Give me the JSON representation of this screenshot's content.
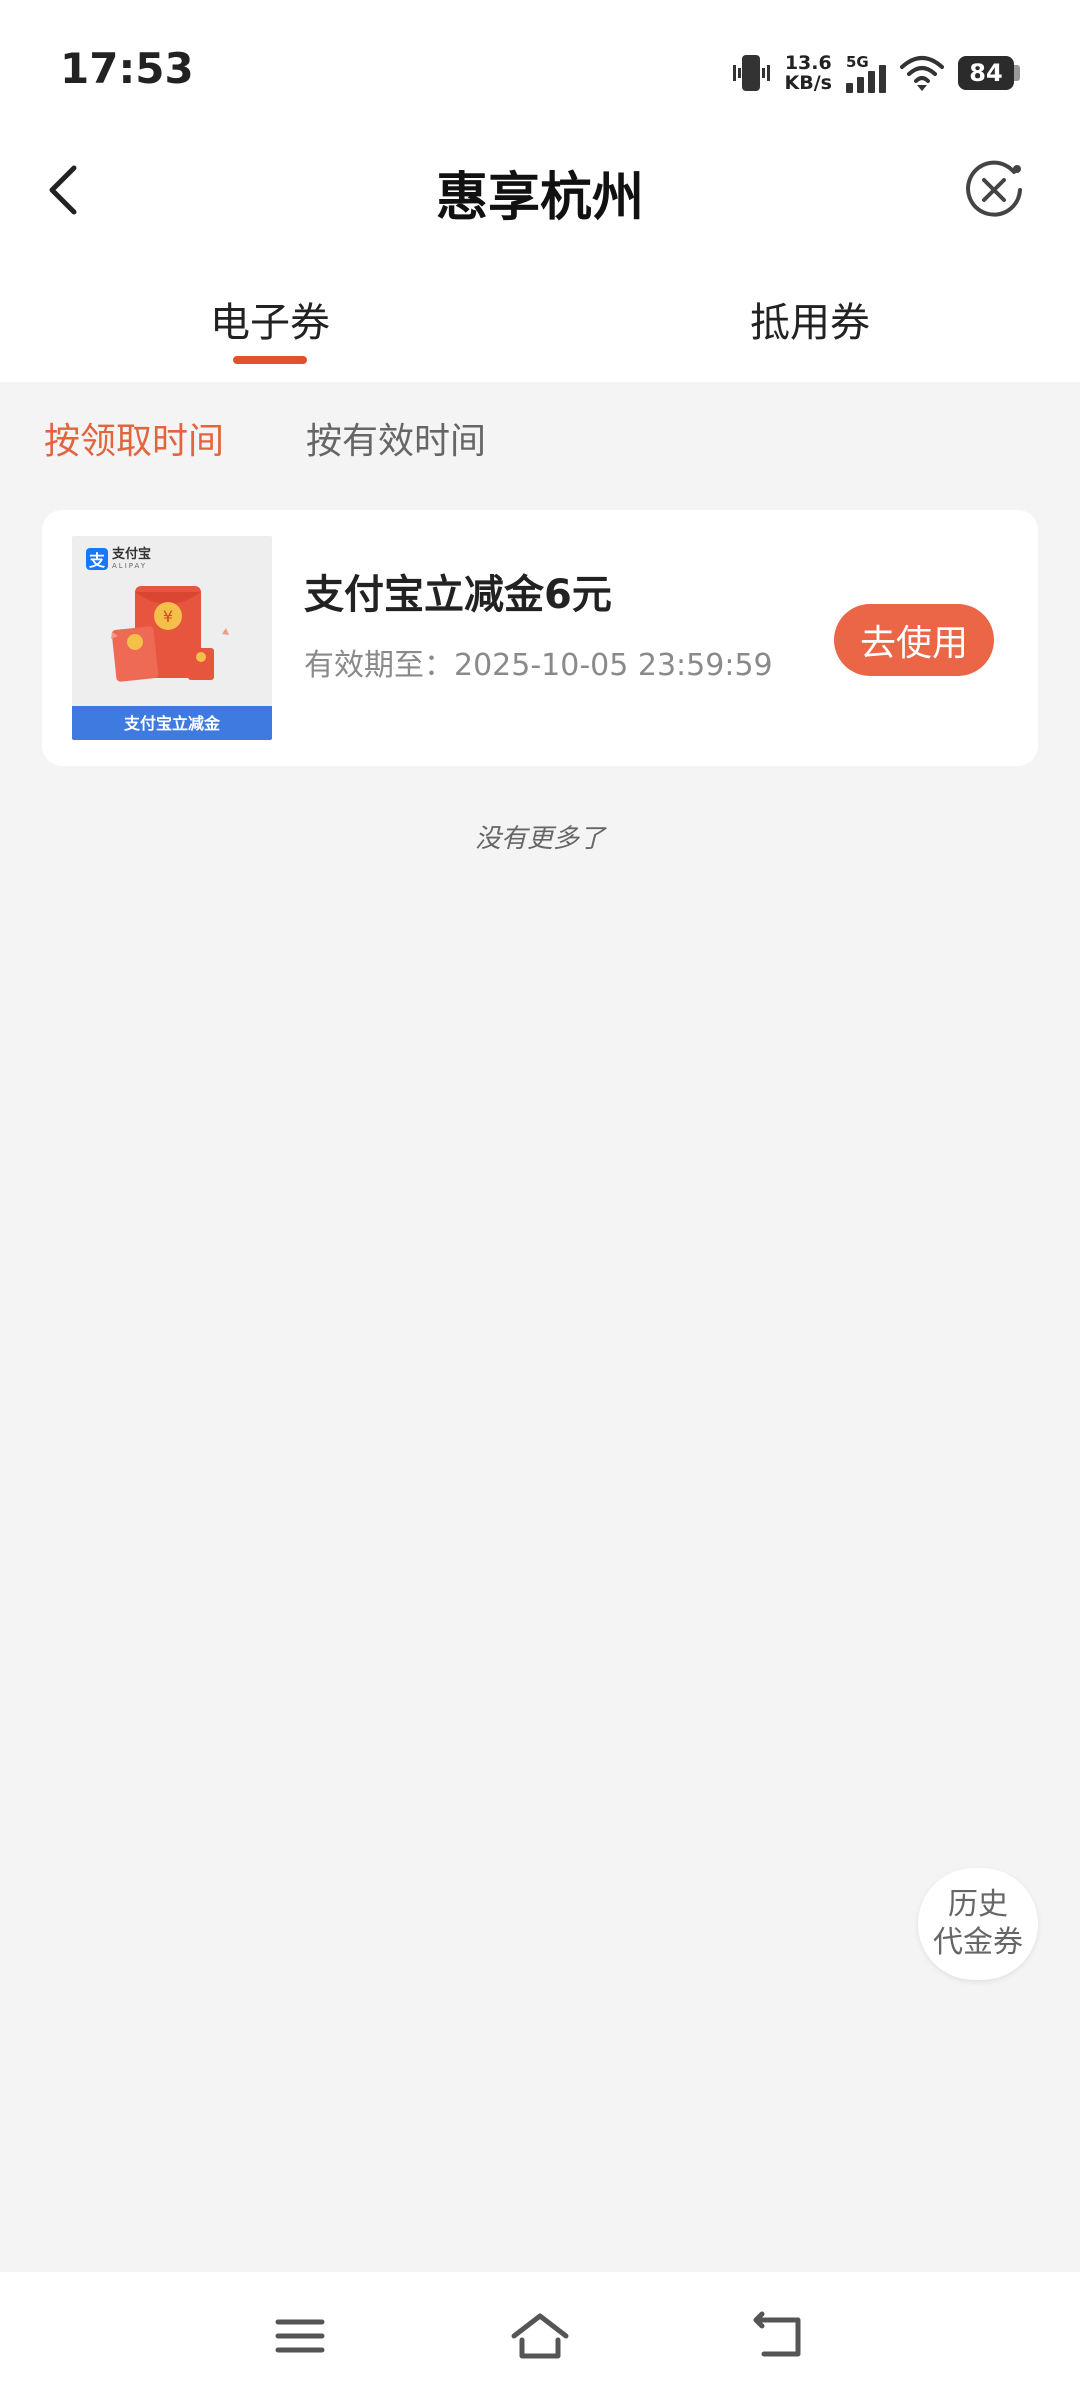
{
  "status_bar": {
    "time": "17:53",
    "net_speed_value": "13.6",
    "net_speed_unit": "KB/s",
    "network_type": "5G",
    "battery": "84"
  },
  "nav": {
    "title": "惠享杭州",
    "back_icon": "back-arrow-icon",
    "close_icon": "close-circle-icon"
  },
  "tabs": [
    {
      "label": "电子券",
      "active": true
    },
    {
      "label": "抵用券",
      "active": false
    }
  ],
  "sort_options": [
    {
      "label": "按领取时间",
      "active": true
    },
    {
      "label": "按有效时间",
      "active": false
    }
  ],
  "coupon": {
    "thumb_logo_text": "支付宝",
    "thumb_logo_sub": "ALIPAY",
    "thumb_banner": "支付宝立减金",
    "name": "支付宝立减金6元",
    "validity": "有效期至：2025-10-05 23:59:59",
    "action_label": "去使用"
  },
  "list_end_text": "没有更多了",
  "history_button": {
    "line1": "历史",
    "line2": "代金券"
  },
  "colors": {
    "accent": "#e0522c",
    "button": "#ea6646",
    "background": "#f4f4f4"
  }
}
